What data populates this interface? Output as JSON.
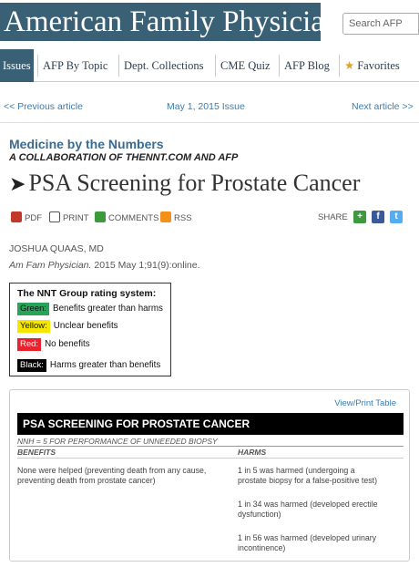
{
  "header": {
    "logo": "American Family Physician",
    "search_placeholder": "Search AFP"
  },
  "nav": {
    "items": [
      "Issues",
      "AFP By Topic",
      "Dept. Collections",
      "CME Quiz",
      "AFP Blog",
      "Favorites"
    ],
    "active": "Issues"
  },
  "article_nav": {
    "prev": "<< Previous article",
    "issue": "May 1, 2015 Issue",
    "next": "Next article >>"
  },
  "article": {
    "section": "Medicine by the Numbers",
    "subtitle": "A COLLABORATION OF THENNT.COM AND AFP",
    "title": "PSA Screening for Prostate Cancer",
    "author": "JOSHUA QUAAS, MD",
    "journal": "Am Fam Physician.",
    "citation": " 2015 May 1;91(9):online."
  },
  "tools": {
    "pdf": "PDF",
    "print": "PRINT",
    "comments": "COMMENTS",
    "rss": "RSS",
    "share": "SHARE"
  },
  "rating": {
    "title": "The NNT Group rating system:",
    "rows": [
      {
        "label": "Green:",
        "text": "Benefits greater than harms",
        "bg": "#27a35a",
        "fg": "#111"
      },
      {
        "label": "Yellow:",
        "text": "Unclear benefits",
        "bg": "#f5e600",
        "fg": "#111"
      },
      {
        "label": "Red:",
        "text": "No benefits",
        "bg": "#e8232e",
        "fg": "#fff"
      },
      {
        "label": "Black:",
        "text": "Harms greater than benefits",
        "bg": "#000000",
        "fg": "#fff"
      }
    ]
  },
  "table": {
    "view_print": "View/Print Table",
    "heading": "PSA SCREENING FOR PROSTATE CANCER",
    "nnh": "NNH = 5 FOR PERFORMANCE OF UNNEEDED BIOPSY",
    "col_benefits": "BENEFITS",
    "col_harms": "HARMS",
    "benefits": [
      "None were helped (preventing death from any cause, preventing death from prostate cancer)"
    ],
    "harms": [
      "1 in 5 was harmed (undergoing a prostate biopsy for a false-positive test)",
      "1 in 34 was harmed (developed erectile dysfunction)",
      "1 in 56 was harmed (developed urinary incontinence)"
    ]
  },
  "colors": {
    "brand": "#3a6076",
    "link": "#3b7cb0",
    "section": "#3b6a91"
  }
}
